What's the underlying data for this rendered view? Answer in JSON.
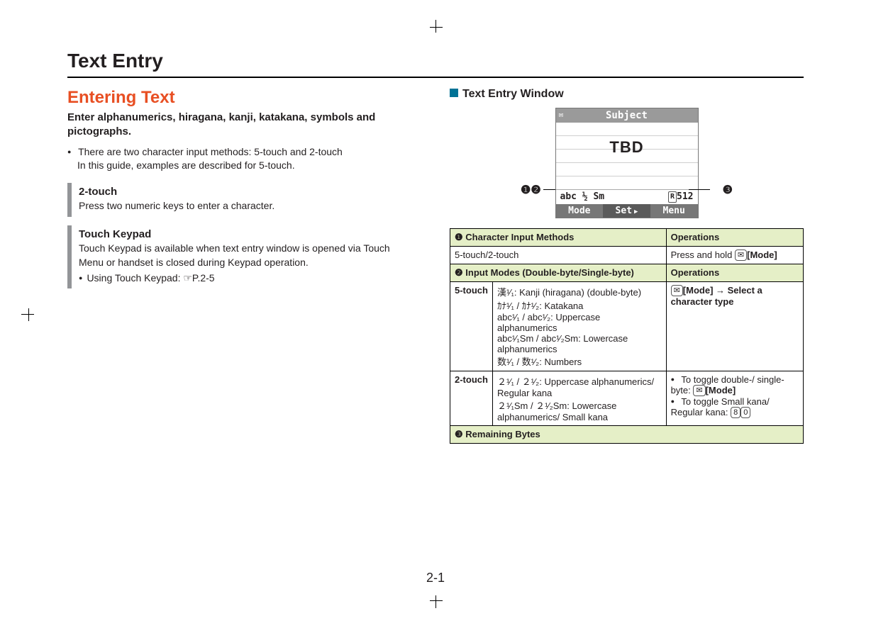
{
  "page": {
    "title": "Text Entry",
    "number": "2-1"
  },
  "left": {
    "heading": "Entering Text",
    "lead": "Enter alphanumerics, hiragana, kanji, katakana, symbols and pictographs.",
    "intro_bullet_1": "There are two character input methods: 5-touch and 2-touch",
    "intro_bullet_2": "In this guide, examples are described for 5-touch.",
    "note1_title": "2-touch",
    "note1_body": "Press two numeric keys to enter a character.",
    "note2_title": "Touch Keypad",
    "note2_body": "Touch Keypad is available when text entry window is opened via Touch Menu or handset is closed during Keypad operation.",
    "note2_bullet": "Using Touch Keypad: ☞P.2-5"
  },
  "right": {
    "subheading": "Text Entry Window",
    "phone": {
      "title": "Subject",
      "body": "TBD",
      "status_left": "abc ½ Sm",
      "status_right_marker": "R",
      "status_right_value": "512",
      "softkey_left": "Mode",
      "softkey_mid": "Set",
      "softkey_right": "Menu"
    },
    "callouts": {
      "left": "❶❷",
      "right": "❸"
    },
    "table": {
      "h1a": "❶ Character Input Methods",
      "h1b": "Operations",
      "r1a": "5-touch/2-touch",
      "r1b_prefix": "Press and hold ",
      "r1b_key": "✉",
      "r1b_suffix": "[Mode]",
      "h2a": "❷ Input Modes (Double-byte/Single-byte)",
      "h2b": "Operations",
      "r2_label": "5-touch",
      "r2_modes_1": "漢¹⁄₁: Kanji (hiragana) (double-byte)",
      "r2_modes_2": "ｶﾅ¹⁄₁ / ｶﾅ¹⁄₂: Katakana",
      "r2_modes_3": "abc¹⁄₁ / abc¹⁄₂: Uppercase alphanumerics",
      "r2_modes_4": "abc¹⁄₁Sm / abc¹⁄₂Sm: Lowercase alphanumerics",
      "r2_modes_5": "数¹⁄₁ / 数¹⁄₂: Numbers",
      "r2_op_key": "✉",
      "r2_op_text": "[Mode] → Select a character type",
      "r3_label": "2-touch",
      "r3_modes_1": "２¹⁄₁ / ２¹⁄₂: Uppercase alphanumerics/ Regular kana",
      "r3_modes_2": "２¹⁄₁Sm / ２¹⁄₂Sm: Lowercase alphanumerics/ Small kana",
      "r3_op_1_pre": "To toggle double-/ single-byte: ",
      "r3_op_1_key": "✉",
      "r3_op_1_post": "[Mode]",
      "r3_op_2_pre": "To toggle Small kana/ Regular kana: ",
      "r3_op_2_key1": "8",
      "r3_op_2_key2": "0",
      "h3": "❸ Remaining Bytes"
    }
  }
}
